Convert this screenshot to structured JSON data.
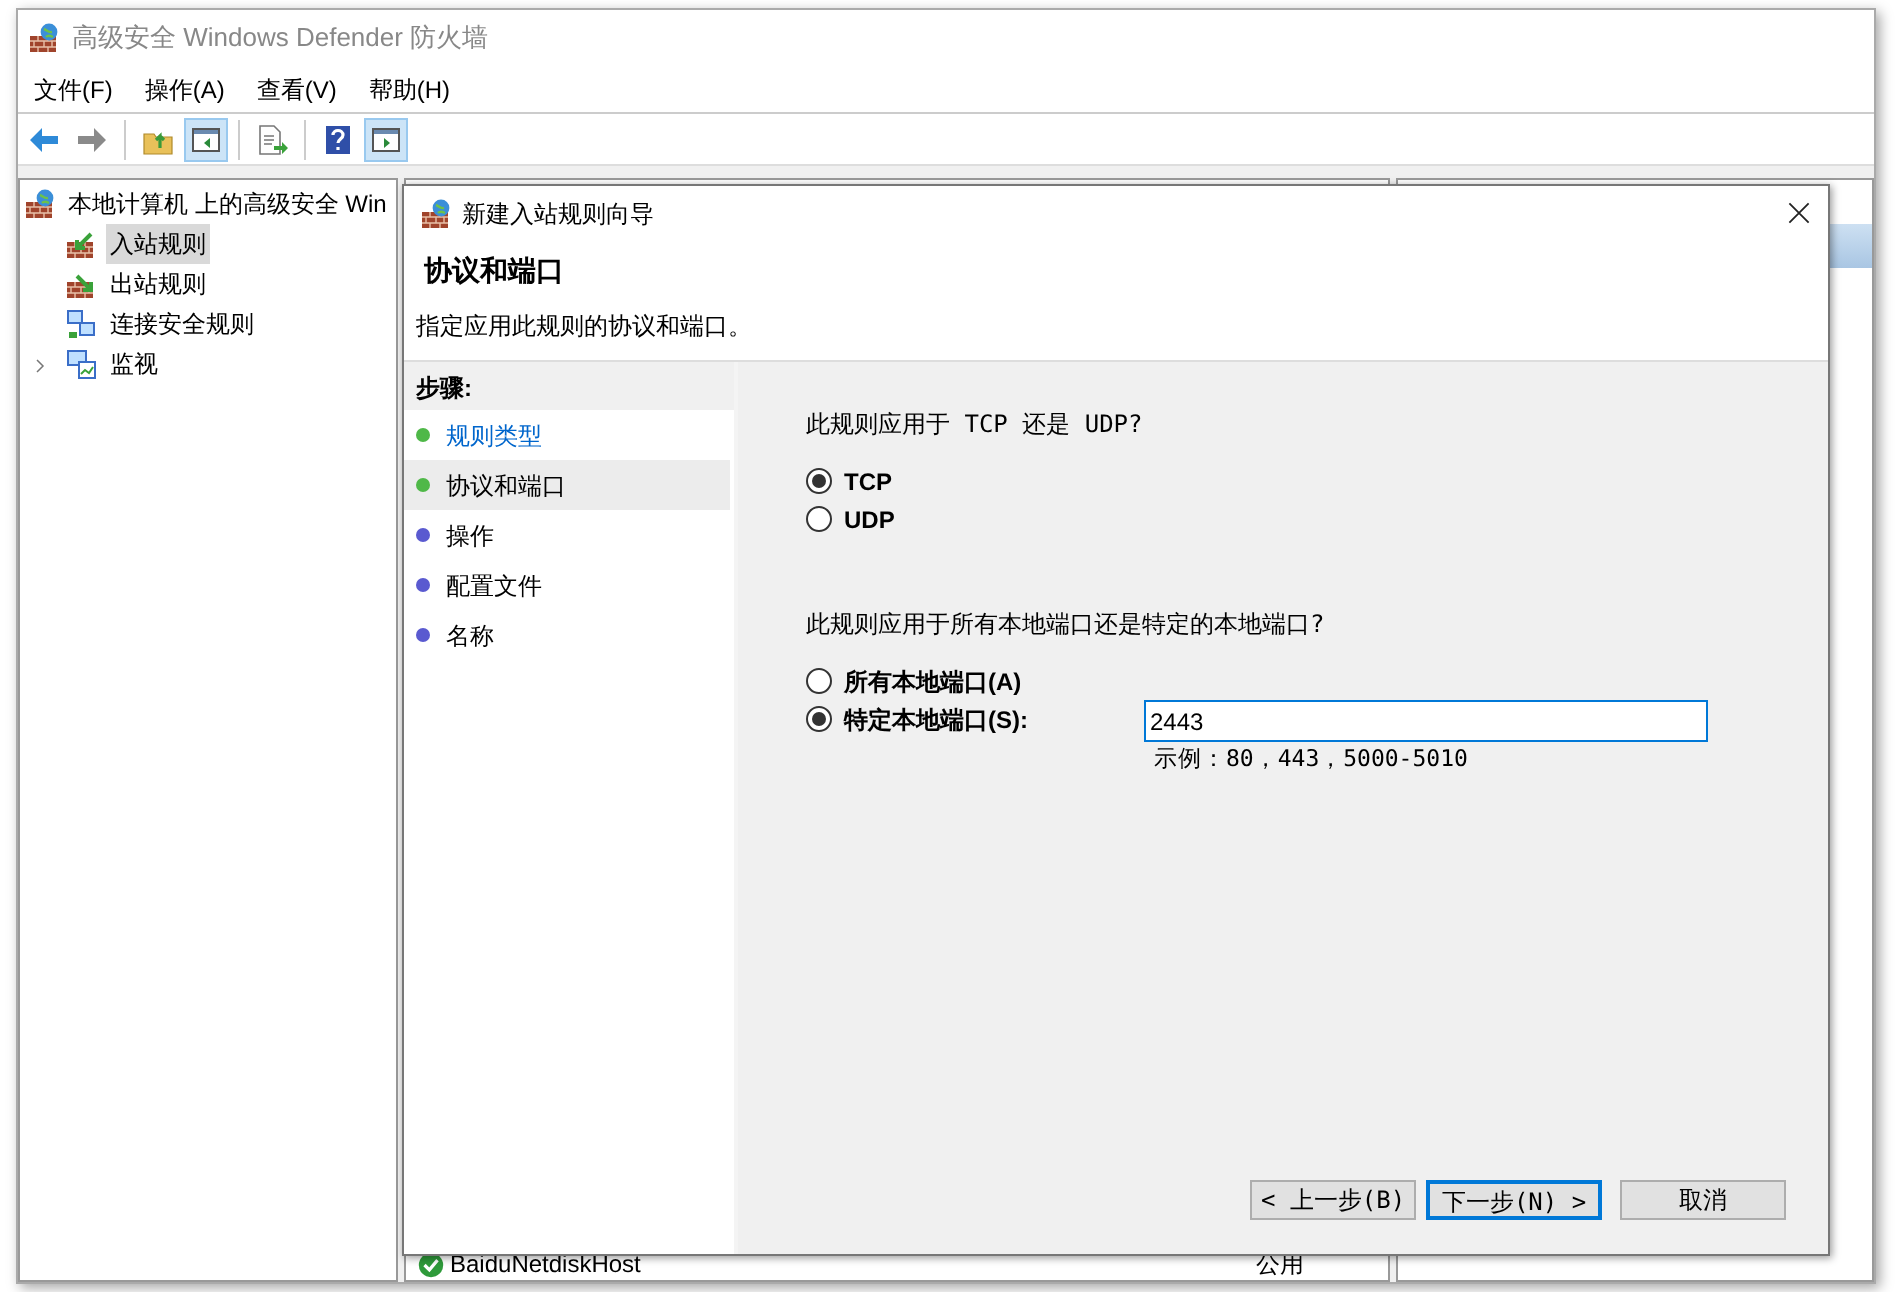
{
  "window": {
    "title": "高级安全 Windows Defender 防火墙"
  },
  "menu": [
    "文件(F)",
    "操作(A)",
    "查看(V)",
    "帮助(H)"
  ],
  "toolbar": [
    {
      "kind": "back",
      "pressed": false
    },
    {
      "kind": "forward",
      "pressed": false
    },
    {
      "kind": "up",
      "pressed": false
    },
    {
      "kind": "tree",
      "pressed": true
    },
    {
      "kind": "export",
      "pressed": false
    },
    {
      "kind": "help",
      "pressed": false
    },
    {
      "kind": "actions",
      "pressed": true
    }
  ],
  "tree": {
    "label": "本地计算机 上的高级安全 Win",
    "children": [
      {
        "label": "入站规则",
        "kind": "inbound",
        "selected": true
      },
      {
        "label": "出站规则",
        "kind": "outbound",
        "selected": false
      },
      {
        "label": "连接安全规则",
        "kind": "connection",
        "selected": false
      },
      {
        "label": "监视",
        "kind": "monitor",
        "selected": false,
        "expanded": false
      }
    ]
  },
  "rule_list": {
    "rows": [
      {
        "name": "BaiduNetdiskHost",
        "profile": "公用",
        "enabled": true
      }
    ]
  },
  "dialog": {
    "title": "新建入站规则向导",
    "heading": "协议和端口",
    "subtitle": "指定应用此规则的协议和端口。",
    "steps_title": "步骤:",
    "steps": [
      {
        "label": "规则类型",
        "color": "#4fb848",
        "selected": false,
        "done": true
      },
      {
        "label": "协议和端口",
        "color": "#4fb848",
        "selected": true,
        "done": false
      },
      {
        "label": "操作",
        "color": "#5a5ad0",
        "selected": false,
        "done": false
      },
      {
        "label": "配置文件",
        "color": "#5a5ad0",
        "selected": false,
        "done": false
      },
      {
        "label": "名称",
        "color": "#5a5ad0",
        "selected": false,
        "done": false
      }
    ],
    "protocol_question": "此规则应用于 TCP 还是 UDP?",
    "protocols": [
      {
        "label": "TCP",
        "selected": true
      },
      {
        "label": "UDP",
        "selected": false
      }
    ],
    "port_question": "此规则应用于所有本地端口还是特定的本地端口?",
    "ports": [
      {
        "label": "所有本地端口(A)",
        "selected": false
      },
      {
        "label": "特定本地端口(S):",
        "selected": true
      }
    ],
    "port_field": {
      "value": "2443"
    },
    "example": "示例：80，443，5000-5010",
    "buttons": [
      {
        "label": "< 上一步(B)",
        "default": false
      },
      {
        "label": "下一步(N) >",
        "default": true
      },
      {
        "label": "取消",
        "default": false
      }
    ]
  }
}
